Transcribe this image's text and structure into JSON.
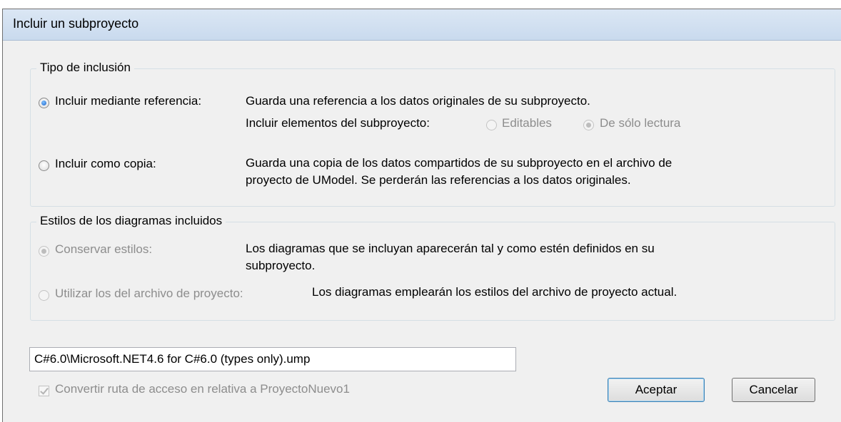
{
  "window": {
    "title": "Incluir un subproyecto"
  },
  "inclusion_group": {
    "legend": "Tipo de inclusión",
    "by_reference": {
      "label": "Incluir mediante referencia:",
      "description": "Guarda una referencia a los datos originales de su subproyecto.",
      "elements_label": "Incluir elementos del subproyecto:",
      "options": [
        {
          "label": "Editables",
          "checked": false,
          "enabled": false
        },
        {
          "label": "De sólo lectura",
          "checked": true,
          "enabled": false
        }
      ],
      "checked": true
    },
    "as_copy": {
      "label": "Incluir como copia:",
      "description_line1": "Guarda una copia de los datos compartidos de su subproyecto en el archivo de",
      "description_line2": "proyecto de UModel. Se perderán las referencias a los datos originales.",
      "checked": false
    }
  },
  "styles_group": {
    "legend": "Estilos de los diagramas incluidos",
    "keep_styles": {
      "label": "Conservar estilos:",
      "description_line1": "Los diagramas que se incluyan aparecerán tal y como estén definidos en su",
      "description_line2": "subproyecto.",
      "checked": true,
      "enabled": false
    },
    "use_project": {
      "label": "Utilizar los del archivo de proyecto:",
      "description": "Los diagramas emplearán los estilos del archivo de proyecto actual.",
      "checked": false,
      "enabled": false
    }
  },
  "path_field": {
    "value": "C#6.0\\Microsoft.NET4.6 for C#6.0 (types only).ump"
  },
  "relative_checkbox": {
    "label": "Convertir ruta de acceso en relativa a ProyectoNuevo1",
    "checked": true,
    "enabled": false
  },
  "buttons": {
    "ok": "Aceptar",
    "cancel": "Cancelar"
  }
}
